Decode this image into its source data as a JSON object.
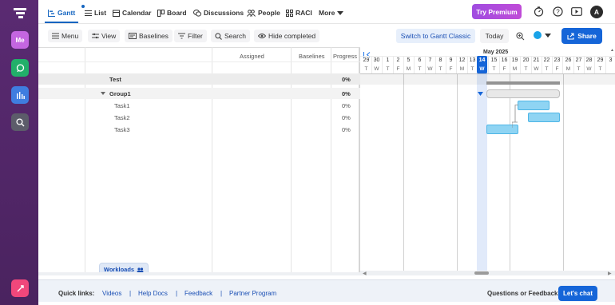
{
  "nav": {
    "tabs": [
      {
        "label": "Gantt"
      },
      {
        "label": "List"
      },
      {
        "label": "Calendar"
      },
      {
        "label": "Board"
      },
      {
        "label": "Discussions"
      },
      {
        "label": "People"
      },
      {
        "label": "RACI"
      },
      {
        "label": "More"
      }
    ],
    "try_premium": "Try Premium",
    "avatar_initial": "A"
  },
  "sidebar": {
    "me_label": "Me"
  },
  "toolbar": {
    "menu": "Menu",
    "view": "View",
    "baselines": "Baselines",
    "filter": "Filter",
    "search": "Search",
    "hide_completed": "Hide completed",
    "switch_classic": "Switch to Gantt Classic",
    "today": "Today",
    "share": "Share",
    "color_dot": "#1aa3e8"
  },
  "grid": {
    "columns": {
      "assigned": "Assigned",
      "baselines": "Baselines",
      "progress": "Progress"
    },
    "rows": [
      {
        "name": "Test",
        "progress": "0%"
      },
      {
        "name": "Group1",
        "progress": "0%"
      },
      {
        "name": "Task1",
        "progress": "0%"
      },
      {
        "name": "Task2",
        "progress": "0%"
      },
      {
        "name": "Task3",
        "progress": "0%"
      }
    ],
    "workloads": "Workloads"
  },
  "timeline": {
    "month": "May 2025",
    "days": [
      {
        "d": "29",
        "w": "T"
      },
      {
        "d": "30",
        "w": "W"
      },
      {
        "d": "1",
        "w": "T"
      },
      {
        "d": "2",
        "w": "F"
      },
      {
        "d": "5",
        "w": "M"
      },
      {
        "d": "6",
        "w": "T"
      },
      {
        "d": "7",
        "w": "W"
      },
      {
        "d": "8",
        "w": "T"
      },
      {
        "d": "9",
        "w": "F"
      },
      {
        "d": "12",
        "w": "M"
      },
      {
        "d": "13",
        "w": "T"
      },
      {
        "d": "14",
        "w": "W"
      },
      {
        "d": "15",
        "w": "T"
      },
      {
        "d": "16",
        "w": "F"
      },
      {
        "d": "19",
        "w": "M"
      },
      {
        "d": "20",
        "w": "T"
      },
      {
        "d": "21",
        "w": "W"
      },
      {
        "d": "22",
        "w": "T"
      },
      {
        "d": "23",
        "w": "F"
      },
      {
        "d": "26",
        "w": "M"
      },
      {
        "d": "27",
        "w": "T"
      },
      {
        "d": "28",
        "w": "W"
      },
      {
        "d": "29",
        "w": "T"
      },
      {
        "d": "3",
        "w": ""
      }
    ],
    "today_index": 11
  },
  "footer": {
    "quick_links_label": "Quick links:",
    "links": [
      "Videos",
      "Help Docs",
      "Feedback",
      "Partner Program"
    ],
    "separator": "|",
    "questions": "Questions or Feedback?",
    "chat": "Let's chat"
  }
}
